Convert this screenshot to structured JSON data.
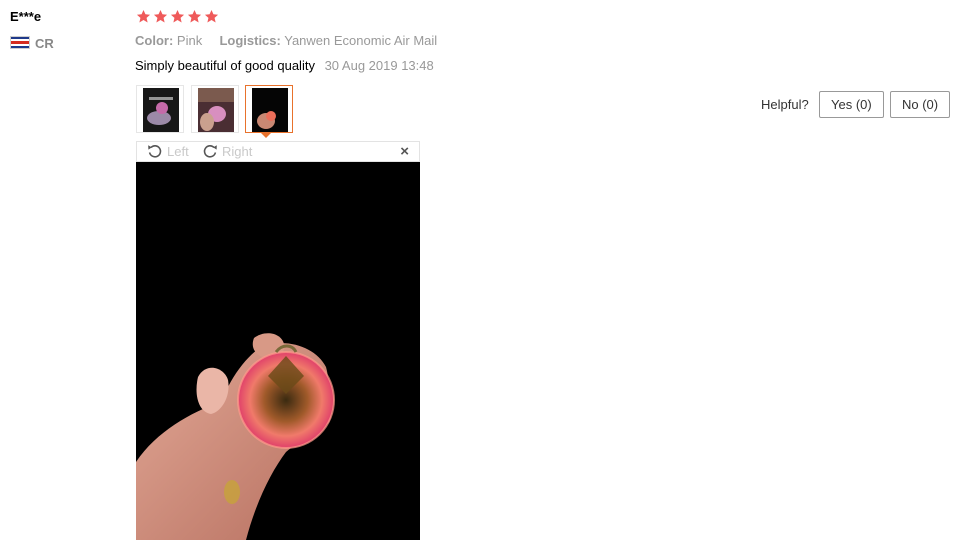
{
  "reviewer": {
    "name": "E***e",
    "country_code": "CR",
    "flag_icon": "costa-rica-flag-icon"
  },
  "rating": {
    "stars": 5,
    "max": 5,
    "star_color": "#ef5a5a"
  },
  "attributes": {
    "color_label": "Color:",
    "color_value": "Pink",
    "logistics_label": "Logistics:",
    "logistics_value": "Yanwen Economic Air Mail"
  },
  "review": {
    "text": "Simply beautiful of good quality",
    "date": "30 Aug 2019 13:48"
  },
  "photos": {
    "count": 3,
    "selected_index": 2,
    "accent": "#e8722c"
  },
  "helpful": {
    "label": "Helpful?",
    "yes_label": "Yes (0)",
    "no_label": "No (0)"
  },
  "viewer": {
    "rotate_left_label": "Left",
    "rotate_right_label": "Right",
    "close_label": "×"
  }
}
